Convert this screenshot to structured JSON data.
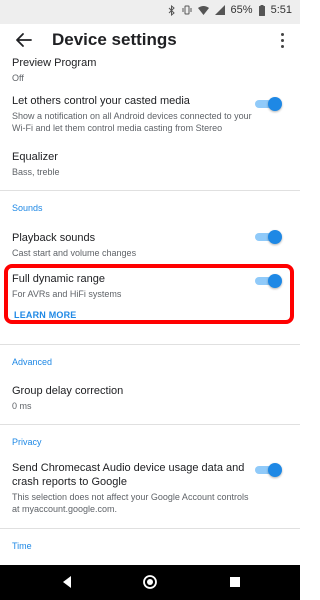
{
  "status_bar": {
    "battery_percent": "65%",
    "time": "5:51"
  },
  "app_bar": {
    "title": "Device settings"
  },
  "items": {
    "preview_program": {
      "title": "Preview Program",
      "subtitle": "Off"
    },
    "let_others_control": {
      "title": "Let others control your casted media",
      "subtitle": "Show a notification on all Android devices connected to your Wi-Fi and let them control media casting from Stereo",
      "toggle_on": true
    },
    "equalizer": {
      "title": "Equalizer",
      "subtitle": "Bass, treble"
    },
    "playback_sounds": {
      "title": "Playback sounds",
      "subtitle": "Cast start and volume changes",
      "toggle_on": true
    },
    "full_dynamic_range": {
      "title": "Full dynamic range",
      "subtitle": "For AVRs and HiFi systems",
      "link": "LEARN MORE",
      "toggle_on": true
    },
    "group_delay": {
      "title": "Group delay correction",
      "subtitle": "0 ms"
    },
    "send_data": {
      "title": "Send Chromecast Audio device usage data and crash reports to Google",
      "subtitle": "This selection does not affect your Google Account controls at myaccount.google.com.",
      "toggle_on": true
    }
  },
  "sections": {
    "sounds": "Sounds",
    "advanced": "Advanced",
    "privacy": "Privacy",
    "time": "Time"
  },
  "colors": {
    "accent": "#1e88e5",
    "highlight": "#ff0000"
  }
}
